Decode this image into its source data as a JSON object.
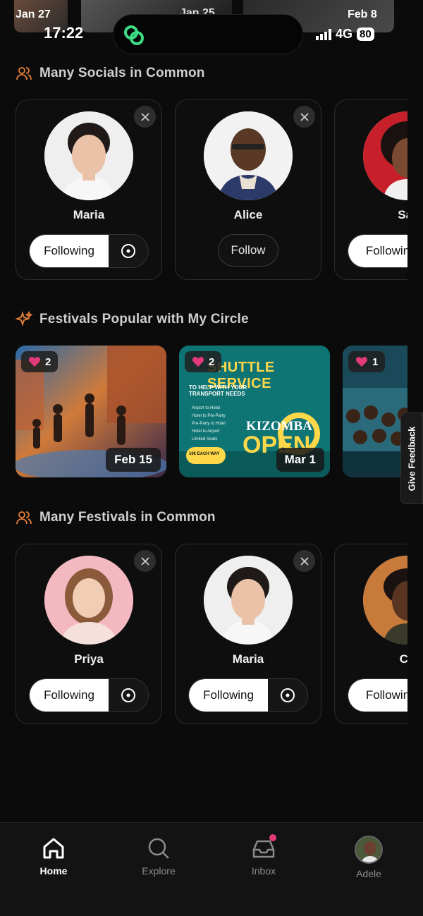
{
  "status_bar": {
    "time": "17:22",
    "network": "4G",
    "battery": "80"
  },
  "top_strip": {
    "dates": [
      "Jan 27",
      "Jan 25",
      "Feb 8"
    ]
  },
  "sections": {
    "socials": {
      "title": "Many Socials in Common"
    },
    "festivals": {
      "title": "Festivals Popular with My Circle"
    },
    "festivals_common": {
      "title": "Many Festivals in Common"
    }
  },
  "socials_people": [
    {
      "name": "Maria",
      "action": "Following"
    },
    {
      "name": "Alice",
      "action": "Follow"
    },
    {
      "name": "Sar",
      "action": "Followin"
    }
  ],
  "festival_cards": [
    {
      "likes": "2",
      "date": "Feb 15"
    },
    {
      "likes": "2",
      "date": "Mar 1",
      "poster_heading": "SHUTTLE SERVICE",
      "poster_sub": "TO HELP WITH YOUR TRANSPORT NEEDS",
      "poster_brand": "KIZOMBA",
      "poster_word": "OPEN",
      "poster_price": "10€ EACH WAY",
      "poster_items": [
        "Airport to Hotel",
        "Hotel to Pre-Party",
        "Pre-Party to Hotel",
        "Hotel to Airport",
        "Limited Seats"
      ]
    },
    {
      "likes": "1"
    }
  ],
  "festival_people": [
    {
      "name": "Priya",
      "action": "Following"
    },
    {
      "name": "Maria",
      "action": "Following"
    },
    {
      "name": "Ch",
      "action": "Followin"
    }
  ],
  "feedback_tab": "Give Feedback",
  "bottom_nav": [
    {
      "label": "Home",
      "icon": "home-icon",
      "active": true
    },
    {
      "label": "Explore",
      "icon": "search-icon",
      "active": false
    },
    {
      "label": "Inbox",
      "icon": "inbox-icon",
      "active": false
    },
    {
      "label": "Adele",
      "icon": "avatar",
      "active": false
    }
  ],
  "colors": {
    "accent_orange": "#e8823a",
    "accent_pink": "#e33a7a",
    "logo_green": "#3ddc84",
    "background": "#0b0b0b"
  }
}
